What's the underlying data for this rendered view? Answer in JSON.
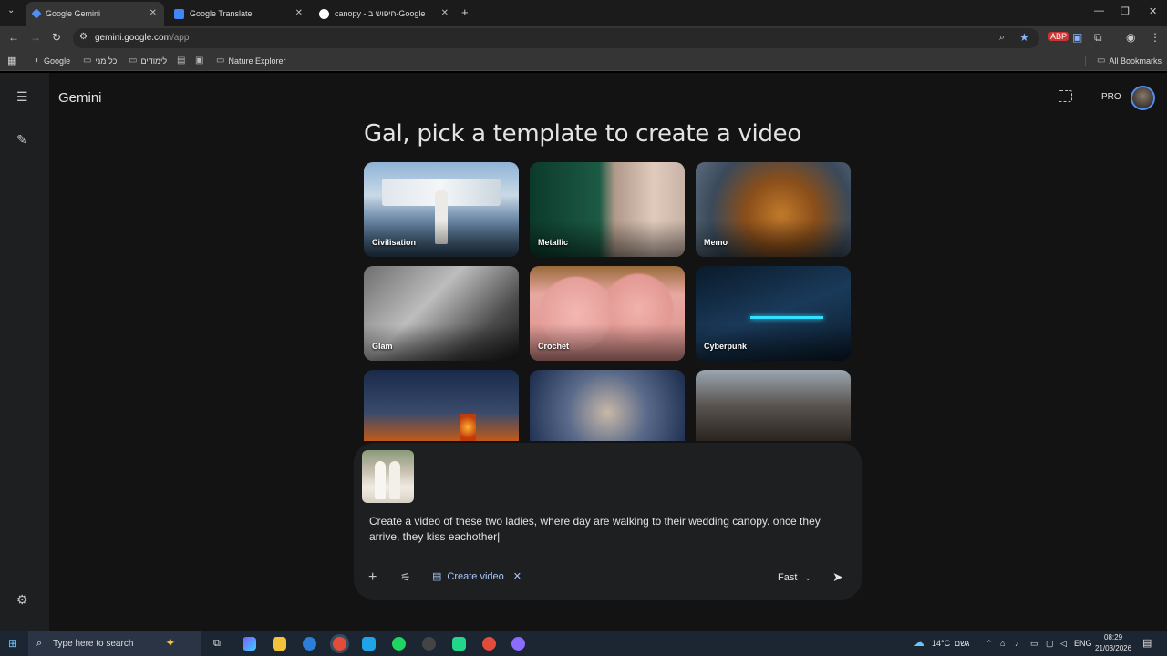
{
  "browser": {
    "tabs": [
      {
        "title": "Google Gemini",
        "active": true
      },
      {
        "title": "Google Translate",
        "active": false
      },
      {
        "title": "canopy - חיפוש ב-Google",
        "active": false
      }
    ],
    "url_host": "gemini.google.com",
    "url_path": "/app",
    "bookmarks": [
      "Google",
      "כל מני",
      "לימודים",
      "Nature Explorer"
    ],
    "all_bookmarks": "All Bookmarks"
  },
  "app": {
    "brand": "Gemini",
    "plan": "PRO",
    "heading": "Gal, pick a template to create a video",
    "templates": [
      {
        "label": "Civilisation",
        "icon": "temple-image"
      },
      {
        "label": "Metallic",
        "icon": "metallic-face-image"
      },
      {
        "label": "Memo",
        "icon": "orangutan-image"
      },
      {
        "label": "Glam",
        "icon": "portrait-image"
      },
      {
        "label": "Crochet",
        "icon": "crochet-pigs-image"
      },
      {
        "label": "Cyberpunk",
        "icon": "motorcycle-image"
      },
      {
        "label": "",
        "icon": "city-night-image"
      },
      {
        "label": "",
        "icon": "face-closeup-image"
      },
      {
        "label": "",
        "icon": "action-man-image"
      }
    ],
    "composer": {
      "prompt": "Create a video of these two ladies, where day are walking to their wedding canopy. once they arrive, they kiss eachother|",
      "chip_label": "Create video",
      "mode": "Fast"
    }
  },
  "taskbar": {
    "search_placeholder": "Type here to search",
    "weather": "14°C",
    "weather_desc": "גשם",
    "lang": "ENG",
    "time": "08:29",
    "date": "21/03/2026"
  },
  "colors": {
    "accent": "#a8c7fa",
    "app_bg": "#131314",
    "composer_bg": "#1e1f20"
  }
}
